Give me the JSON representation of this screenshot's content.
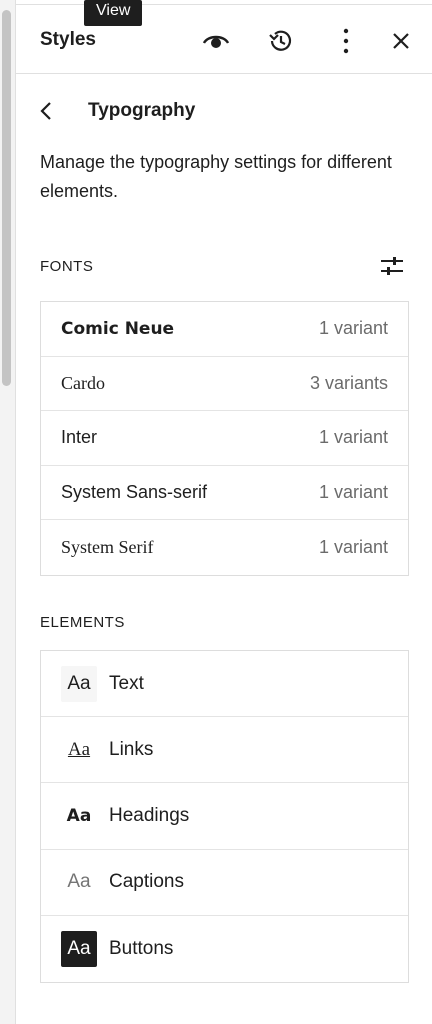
{
  "header": {
    "title": "Styles",
    "tooltip": "View"
  },
  "nav": {
    "title": "Typography"
  },
  "description": "Manage the typography settings for different elements.",
  "fonts_section": {
    "label": "FONTS",
    "items": [
      {
        "name": "Comic Neue",
        "variants": "1 variant"
      },
      {
        "name": "Cardo",
        "variants": "3 variants"
      },
      {
        "name": "Inter",
        "variants": "1 variant"
      },
      {
        "name": "System Sans-serif",
        "variants": "1 variant"
      },
      {
        "name": "System Serif",
        "variants": "1 variant"
      }
    ]
  },
  "elements_section": {
    "label": "ELEMENTS",
    "items": [
      {
        "preview": "Aa",
        "label": "Text"
      },
      {
        "preview": "Aa",
        "label": "Links"
      },
      {
        "preview": "Aa",
        "label": "Headings"
      },
      {
        "preview": "Aa",
        "label": "Captions"
      },
      {
        "preview": "Aa",
        "label": "Buttons"
      }
    ]
  },
  "icons": {
    "view": "eye-icon",
    "revisions": "history-icon",
    "more": "more-vertical-icon",
    "close": "close-icon",
    "back": "chevron-left-icon",
    "font_settings": "sliders-icon"
  },
  "colors": {
    "text": "#1e1e1e",
    "muted": "#6b6b6b",
    "border": "#dddddd",
    "button_bg": "#1e1e1e"
  }
}
